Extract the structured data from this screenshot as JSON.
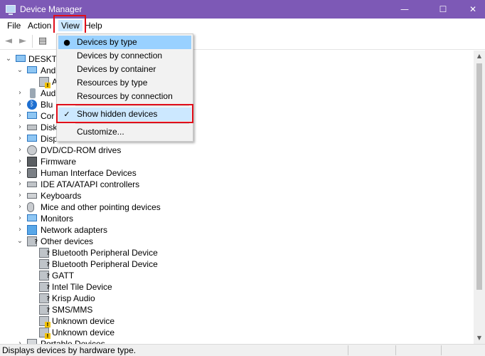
{
  "window": {
    "title": "Device Manager",
    "minimize": "—",
    "maximize": "☐",
    "close": "✕"
  },
  "menubar": {
    "file": "File",
    "action": "Action",
    "view": "View",
    "help": "Help"
  },
  "toolbar": {
    "back": "◄",
    "forward": "►",
    "properties": "▤"
  },
  "tree": {
    "root": "DESKTO",
    "cat_1": "And",
    "cat_1_child": "A",
    "cat_2": "Aud",
    "cat_3": "Blu",
    "cat_4": "Cor",
    "cat_5": "Disk",
    "cat_6": "Disp",
    "dvd": "DVD/CD-ROM drives",
    "firmware": "Firmware",
    "hid": "Human Interface Devices",
    "ide": "IDE ATA/ATAPI controllers",
    "keyboards": "Keyboards",
    "mice": "Mice and other pointing devices",
    "monitors": "Monitors",
    "network": "Network adapters",
    "other": "Other devices",
    "other_items": [
      "Bluetooth Peripheral Device",
      "Bluetooth Peripheral Device",
      "GATT",
      "Intel Tile Device",
      "Krisp Audio",
      "SMS/MMS",
      "Unknown device",
      "Unknown device"
    ],
    "portable": "Portable Devices"
  },
  "view_menu": {
    "devices_by_type": "Devices by type",
    "devices_by_connection": "Devices by connection",
    "devices_by_container": "Devices by container",
    "resources_by_type": "Resources by type",
    "resources_by_connection": "Resources by connection",
    "show_hidden": "Show hidden devices",
    "customize": "Customize...",
    "radio_mark": "●",
    "check_mark": "✓"
  },
  "statusbar": {
    "text": "Displays devices by hardware type."
  },
  "colors": {
    "titlebar": "#7d59b6",
    "highlight": "#99d1ff",
    "annotation_red": "#e10e1a"
  }
}
